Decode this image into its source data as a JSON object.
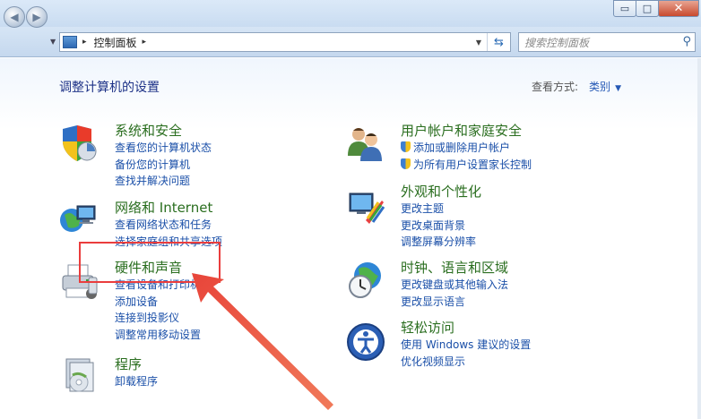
{
  "window": {
    "minimize": "▭",
    "restore": "□",
    "close": "✕"
  },
  "nav": {
    "back_icon": "back-arrow-icon",
    "forward_icon": "forward-arrow-icon"
  },
  "address": {
    "breadcrumb": "控制面板",
    "separator": "▸"
  },
  "search": {
    "placeholder": "搜索控制面板"
  },
  "header": {
    "title": "调整计算机的设置",
    "view_label": "查看方式:",
    "view_value": "类别"
  },
  "categories": {
    "security": {
      "title": "系统和安全",
      "links": [
        "查看您的计算机状态",
        "备份您的计算机",
        "查找并解决问题"
      ]
    },
    "network": {
      "title": "网络和 Internet",
      "links": [
        "查看网络状态和任务",
        "选择家庭组和共享选项"
      ]
    },
    "hardware": {
      "title": "硬件和声音",
      "links": [
        "查看设备和打印机",
        "添加设备",
        "连接到投影仪",
        "调整常用移动设置"
      ]
    },
    "programs": {
      "title": "程序",
      "links": [
        "卸载程序"
      ]
    },
    "users": {
      "title": "用户帐户和家庭安全",
      "links": [
        "添加或删除用户帐户",
        "为所有用户设置家长控制"
      ]
    },
    "appearance": {
      "title": "外观和个性化",
      "links": [
        "更改主题",
        "更改桌面背景",
        "调整屏幕分辨率"
      ]
    },
    "clock": {
      "title": "时钟、语言和区域",
      "links": [
        "更改键盘或其他输入法",
        "更改显示语言"
      ]
    },
    "ease": {
      "title": "轻松访问",
      "links": [
        "使用 Windows 建议的设置",
        "优化视频显示"
      ]
    }
  },
  "colors": {
    "category_title": "#2a6e1f",
    "link": "#1a4fa8",
    "page_title": "#1e3287",
    "annotation": "#ea3d3d"
  }
}
